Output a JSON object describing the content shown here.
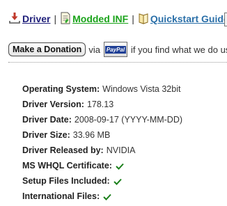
{
  "links": {
    "driver": {
      "label": "Driver",
      "icon": "download-icon"
    },
    "modded_inf": {
      "label": "Modded INF",
      "icon": "document-icon"
    },
    "quickstart": {
      "label": "Quickstart Guide",
      "icon": "book-icon"
    },
    "separator": "|"
  },
  "donation": {
    "button_label": "Make a Donation",
    "via_text": "via",
    "paypal_label": "PayPal",
    "suffix_text": "if you find what we do us"
  },
  "details": {
    "os": {
      "label": "Operating System:",
      "value": "Windows Vista 32bit"
    },
    "version": {
      "label": "Driver Version:",
      "value": "178.13"
    },
    "date": {
      "label": "Driver Date:",
      "value": "2008-09-17 (YYYY-MM-DD)"
    },
    "size": {
      "label": "Driver Size:",
      "value": "33.96 MB"
    },
    "released_by": {
      "label": "Driver Released by:",
      "value": "NVIDIA"
    },
    "whql": {
      "label": "MS WHQL Certificate:",
      "check_icon": "checkmark-icon"
    },
    "setup_files": {
      "label": "Setup Files Included:",
      "check_icon": "checkmark-icon"
    },
    "international": {
      "label": "International Files:",
      "check_icon": "checkmark-icon"
    }
  },
  "colors": {
    "driver_link": "#1f1f7a",
    "modded_inf_link": "#1aa31a",
    "quickstart_link": "#2a6fa8",
    "check_green": "#1a7f1a",
    "paypal_blue": "#1f3f95"
  }
}
